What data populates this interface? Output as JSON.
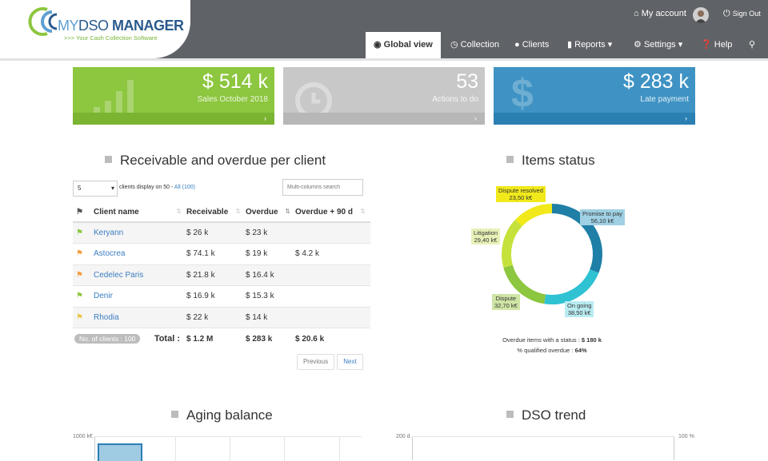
{
  "brand": {
    "my": "MY",
    "dso": "DSO",
    "manager": "MANAGER",
    "tagline": ">>> Your Cash Collection Software"
  },
  "header": {
    "account": "My account",
    "signout": "Sign Out"
  },
  "nav": {
    "global": "Global view",
    "collection": "Collection",
    "clients": "Clients",
    "reports": "Reports",
    "settings": "Settings",
    "help": "Help"
  },
  "tiles": [
    {
      "value": "$ 514 k",
      "label": "Sales October 2018",
      "color": "#8dc63f",
      "foot": "#7ab431"
    },
    {
      "value": "53",
      "label": "Actions to do",
      "color": "#c8c8c8",
      "foot": "#b7b7b7"
    },
    {
      "value": "$ 283 k",
      "label": "Late payment",
      "color": "#3f93c4",
      "foot": "#2a7fb3"
    }
  ],
  "receivable": {
    "title": "Receivable and overdue per client",
    "page_size": "5",
    "display_text": "clients display on 50 -",
    "all_link": "All (100)",
    "search_placeholder": "Multi-columns search",
    "columns": {
      "name": "Client name",
      "receivable": "Receivable",
      "overdue": "Overdue",
      "overdue90": "Overdue + 90 d"
    },
    "rows": [
      {
        "name": "Keryann",
        "receivable": "$ 26 k",
        "overdue": "$ 23 k",
        "overdue90": "",
        "flag": "#8dc63f"
      },
      {
        "name": "Astocrea",
        "receivable": "$ 74.1 k",
        "overdue": "$ 19 k",
        "overdue90": "$ 4.2 k",
        "flag": "#f39c3b"
      },
      {
        "name": "Cedelec Paris",
        "receivable": "$ 21.8 k",
        "overdue": "$ 16.4 k",
        "overdue90": "",
        "flag": "#f39c3b"
      },
      {
        "name": "Denir",
        "receivable": "$ 16.9 k",
        "overdue": "$ 15.3 k",
        "overdue90": "",
        "flag": "#8dc63f"
      },
      {
        "name": "Rhodia",
        "receivable": "$ 22 k",
        "overdue": "$ 14 k",
        "overdue90": "",
        "flag": "#e9c548"
      }
    ],
    "footer": {
      "count": "No. of clients : 100",
      "total_label": "Total :",
      "receivable": "$ 1.2 M",
      "overdue": "$ 283 k",
      "overdue90": "$ 20.6 k"
    },
    "prev": "Previous",
    "next": "Next"
  },
  "items_status": {
    "title": "Items status",
    "slices": [
      {
        "label": "Promise to pay",
        "value": "56,10 k€",
        "amount": 56.1,
        "color": "#1f7fa6"
      },
      {
        "label": "On going",
        "value": "38,50 k€",
        "amount": 38.5,
        "color": "#2ec2d3"
      },
      {
        "label": "Dispute",
        "value": "32,70 k€",
        "amount": 32.7,
        "color": "#8dc63f"
      },
      {
        "label": "Litigation",
        "value": "29,40 k€",
        "amount": 29.4,
        "color": "#c4e23b"
      },
      {
        "label": "Dispute resolved",
        "value": "23,50 k€",
        "amount": 23.5,
        "color": "#f1e91a"
      }
    ],
    "summary1_prefix": "Overdue items with a status :",
    "summary1_value": "$ 180 k",
    "summary2_prefix": "% qualified overdue :",
    "summary2_value": "64%"
  },
  "aging": {
    "title": "Aging balance",
    "ymax": "1000 k€"
  },
  "dso": {
    "title": "DSO trend",
    "ymax": "200 d",
    "ymax_right": "100 %"
  }
}
